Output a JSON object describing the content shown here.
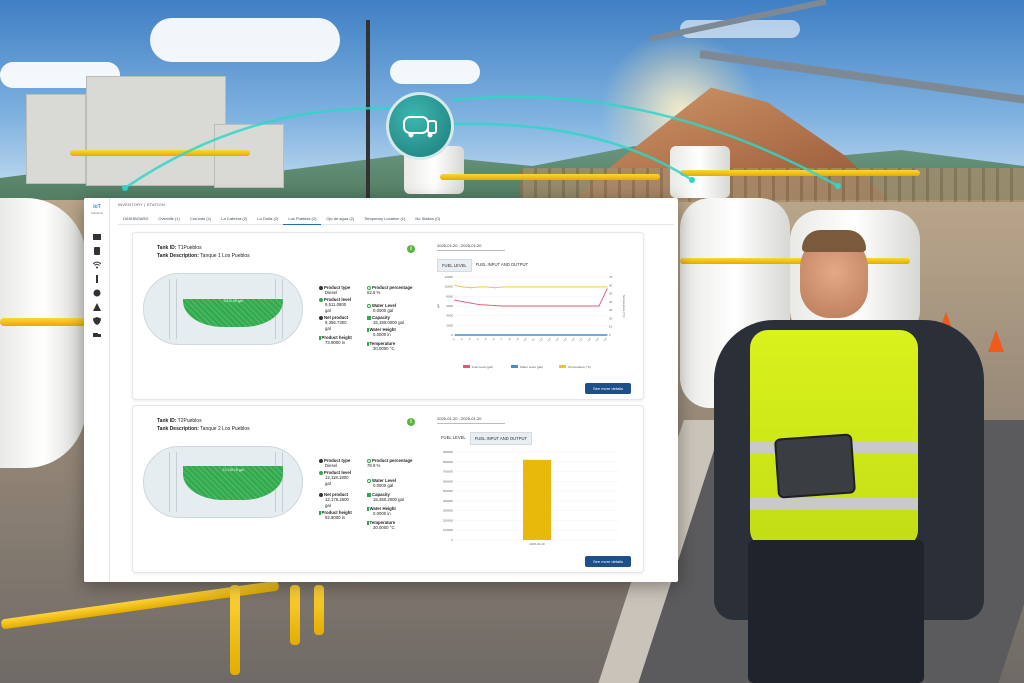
{
  "app": {
    "logo": "IoT",
    "logo_sub": "Solutions",
    "breadcrumb": "INVENTORY  |  STATION",
    "tabs": [
      {
        "label": "DASHBOARD"
      },
      {
        "label": "Overville (1)"
      },
      {
        "label": "Curundú (1)"
      },
      {
        "label": "La Cabrera (2)"
      },
      {
        "label": "La Doña (2)"
      },
      {
        "label": "Los Pueblos (2)"
      },
      {
        "label": "Ojo de agua (2)"
      },
      {
        "label": "Temporary Location (1)"
      },
      {
        "label": "No Station (0)"
      }
    ],
    "active_tab": "Los Pueblos (2)"
  },
  "tanks": [
    {
      "id_label": "Tank ID:",
      "id": "T1Pueblos",
      "desc_label": "Tank Description:",
      "desc": "Tanque 1 Los Pueblos",
      "fill_label": "9,511.08 gal",
      "product_type_label": "Product type",
      "product_type": "Diesel",
      "product_level_label": "Product level",
      "product_level": "9,511.0800",
      "product_level_unit": "gal",
      "net_product_label": "Net product",
      "net_product": "9,356.7300",
      "net_product_unit": "gal",
      "product_height_label": "Product height",
      "product_height": "73.9000 in",
      "percentage_label": "Product percentage",
      "percentage": "62.6 %",
      "water_level_label": "Water Level",
      "water_level": "0.0000 gal",
      "capacity_label": "Capacity",
      "capacity": "15,190.0000 gal",
      "water_height_label": "Water Height",
      "water_height": "0.0000 in",
      "temperature_label": "Temperature",
      "temperature": "30.0000 °C",
      "date_range": "2025-01-20 - 2025-01-20",
      "chart_tabs": [
        "FUEL LEVEL",
        "FUEL INPUT AND OUTPUT"
      ],
      "active_chart_tab": "FUEL LEVEL",
      "button": "See more details"
    },
    {
      "id_label": "Tank ID:",
      "id": "T2Pueblos",
      "desc_label": "Tank Description:",
      "desc": "Tanque 2 Los Pueblos",
      "fill_label": "12,118.18 gal",
      "product_type_label": "Product type",
      "product_type": "Diesel",
      "product_level_label": "Product level",
      "product_level": "12,118.1800",
      "product_level_unit": "gal",
      "net_product_label": "Net product",
      "net_product": "12,176.2500",
      "net_product_unit": "gal",
      "product_height_label": "Product height",
      "product_height": "92.8000 in",
      "percentage_label": "Product percentage",
      "percentage": "78.9 %",
      "water_level_label": "Water Level",
      "water_level": "0.0000 gal",
      "capacity_label": "Capacity",
      "capacity": "15,350.2000 gal",
      "water_height_label": "Water Height",
      "water_height": "0.0000 in",
      "temperature_label": "Temperature",
      "temperature": "30.0000 °C",
      "date_range": "2025-01-20 - 2025-01-20",
      "chart_tabs": [
        "FUEL LEVEL",
        "FUEL INPUT AND OUTPUT"
      ],
      "active_chart_tab": "FUEL INPUT AND OUTPUT",
      "button": "See more details"
    }
  ],
  "colors": {
    "brand": "#1d4f8a",
    "fill_green": "#2faa4b",
    "fuel_level": "#e8557a",
    "water_level": "#3e8fd6",
    "temperature": "#f2c230",
    "bar": "#e8b90a",
    "vest": "#d9f21c"
  },
  "icons": [
    "dashboard-icon",
    "tank-icon",
    "wifi-icon",
    "alert-icon",
    "user-icon",
    "warning-icon",
    "shield-icon",
    "truck-icon",
    "fuel-truck-icon"
  ],
  "chart_data": [
    {
      "type": "line",
      "title": "",
      "x": [
        "t1",
        "t2",
        "t3",
        "t4",
        "t5",
        "t6",
        "t7",
        "t8",
        "t9",
        "t10",
        "t11",
        "t12",
        "t13",
        "t14",
        "t15",
        "t16",
        "t17",
        "t18",
        "t19",
        "t20"
      ],
      "ylim": [
        0,
        12000
      ],
      "y_ticks": [
        "12000",
        "10000",
        "8000",
        "6000",
        "4000",
        "2000",
        "0"
      ],
      "y2lim": [
        0,
        70
      ],
      "y2_ticks": [
        "70",
        "60",
        "50",
        "40",
        "30",
        "20",
        "10",
        "0"
      ],
      "ylabel": "gal",
      "y2label": "Temperature (°C)",
      "series": [
        {
          "name": "Fuel Level (gal)",
          "axis": "left",
          "values": [
            7200,
            6900,
            6600,
            6300,
            6200,
            6100,
            6000,
            6000,
            6000,
            6000,
            6000,
            6000,
            6000,
            6000,
            6000,
            6000,
            6000,
            6000,
            6000,
            9500
          ]
        },
        {
          "name": "Water Level (gal)",
          "axis": "left",
          "values": [
            0,
            0,
            0,
            0,
            0,
            0,
            0,
            0,
            0,
            0,
            0,
            0,
            0,
            0,
            0,
            0,
            0,
            0,
            0,
            0
          ]
        },
        {
          "name": "Temperature (°C)",
          "axis": "right",
          "values": [
            60,
            58,
            57,
            58,
            58,
            57,
            58,
            58,
            58,
            58,
            58,
            58,
            58,
            58,
            58,
            58,
            58,
            58,
            58,
            58
          ]
        }
      ],
      "legend": "bottom"
    },
    {
      "type": "bar",
      "title": "",
      "categories": [
        "2025-01-20"
      ],
      "ylim": [
        0,
        900000
      ],
      "y_ticks": [
        "900000",
        "800000",
        "700000",
        "600000",
        "500000",
        "400000",
        "300000",
        "200000",
        "100000",
        "0"
      ],
      "series": [
        {
          "values": [
            820000
          ]
        }
      ]
    }
  ]
}
